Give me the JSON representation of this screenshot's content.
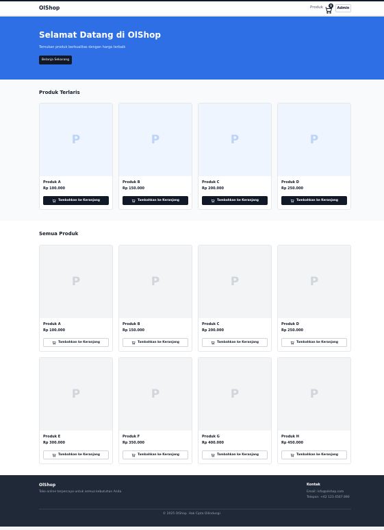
{
  "nav": {
    "brand": "OlShop",
    "link_products": "Produk",
    "cart_count": "0",
    "admin_label": "Admin"
  },
  "hero": {
    "title": "Selamat Datang di OlShop",
    "subtitle": "Temukan produk berkualitas dengan harga terbaik",
    "cta": "Belanja Sekarang"
  },
  "best": {
    "title": "Produk Terlaris",
    "items": [
      {
        "placeholder": "P",
        "name": "Produk A",
        "price": "Rp 100.000",
        "add_label": "Tambahkan ke Keranjang"
      },
      {
        "placeholder": "P",
        "name": "Produk B",
        "price": "Rp 150.000",
        "add_label": "Tambahkan ke Keranjang"
      },
      {
        "placeholder": "P",
        "name": "Produk C",
        "price": "Rp 200.000",
        "add_label": "Tambahkan ke Keranjang"
      },
      {
        "placeholder": "P",
        "name": "Produk D",
        "price": "Rp 250.000",
        "add_label": "Tambahkan ke Keranjang"
      }
    ]
  },
  "all": {
    "title": "Semua Produk",
    "items": [
      {
        "placeholder": "P",
        "name": "Produk A",
        "price": "Rp 100.000",
        "add_label": "Tambahkan ke Keranjang"
      },
      {
        "placeholder": "P",
        "name": "Produk B",
        "price": "Rp 150.000",
        "add_label": "Tambahkan ke Keranjang"
      },
      {
        "placeholder": "P",
        "name": "Produk C",
        "price": "Rp 200.000",
        "add_label": "Tambahkan ke Keranjang"
      },
      {
        "placeholder": "P",
        "name": "Produk D",
        "price": "Rp 250.000",
        "add_label": "Tambahkan ke Keranjang"
      },
      {
        "placeholder": "P",
        "name": "Produk E",
        "price": "Rp 300.000",
        "add_label": "Tambahkan ke Keranjang"
      },
      {
        "placeholder": "P",
        "name": "Produk F",
        "price": "Rp 350.000",
        "add_label": "Tambahkan ke Keranjang"
      },
      {
        "placeholder": "P",
        "name": "Produk G",
        "price": "Rp 400.000",
        "add_label": "Tambahkan ke Keranjang"
      },
      {
        "placeholder": "P",
        "name": "Produk H",
        "price": "Rp 450.000",
        "add_label": "Tambahkan ke Keranjang"
      }
    ]
  },
  "footer": {
    "brand": "OlShop",
    "tagline": "Toko online terpercaya untuk semua kebutuhan Anda",
    "contact_title": "Kontak",
    "email": "Email: info@olshop.com",
    "phone": "Telepon: +62 123 4567 890",
    "copyright": "© 2025 OlShop. Hak Cipta Dilindungi."
  },
  "colors": {
    "primary": "#2f6fe6",
    "dark": "#111827",
    "footer_bg": "#1f2937"
  },
  "icons": {
    "cart": "cart-icon"
  }
}
